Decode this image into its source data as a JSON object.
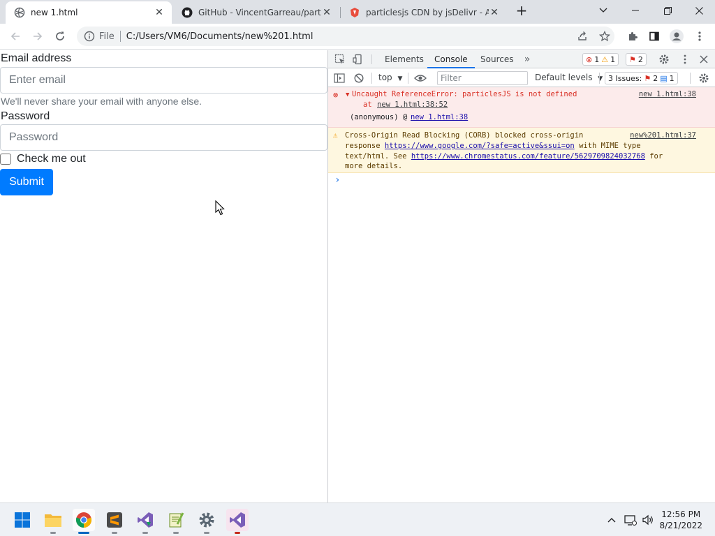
{
  "browser": {
    "tabs": [
      {
        "title": "new 1.html",
        "active": true
      },
      {
        "title": "GitHub - VincentGarreau/particle",
        "active": false
      },
      {
        "title": "particlesjs CDN by jsDelivr - A CD",
        "active": false
      }
    ],
    "address": {
      "scheme_label": "File",
      "url": "C:/Users/VM6/Documents/new%201.html"
    }
  },
  "page": {
    "email_label": "Email address",
    "email_placeholder": "Enter email",
    "email_help": "We'll never share your email with anyone else.",
    "password_label": "Password",
    "password_placeholder": "Password",
    "check_label": "Check me out",
    "submit_label": "Submit"
  },
  "devtools": {
    "tabs": [
      "Elements",
      "Console",
      "Sources"
    ],
    "active_tab": "Console",
    "counts": {
      "errors": "1",
      "warnings": "1",
      "issues_badge": "2"
    },
    "console_bar": {
      "context": "top",
      "filter_placeholder": "Filter",
      "levels": "Default levels",
      "issues_label": "3 Issues:",
      "issues_errors": "2",
      "issues_info": "1"
    },
    "messages": {
      "error": {
        "text": "Uncaught ReferenceError: particlesJS is not defined",
        "at_prefix": "at",
        "at_link": "new 1.html:38:52",
        "source": "new 1.html:38",
        "stack_fn": "(anonymous)",
        "stack_at": "@",
        "stack_link": "new 1.html:38"
      },
      "warning": {
        "line1": "Cross-Origin Read Blocking (CORB) blocked cross-origin",
        "line2_prefix": "response",
        "line2_url": "https://www.google.com/?safe=active&ssui=on",
        "line2_suffix": "with MIME type",
        "line3_prefix": "text/html. See",
        "line3_url": "https://www.chromestatus.com/feature/5629709824032768",
        "line3_suffix": "for",
        "line4": "more details.",
        "source": "new%201.html:37"
      },
      "prompt": "›"
    }
  },
  "taskbar": {
    "time": "12:56 PM",
    "date": "8/21/2022",
    "apps": [
      "start-icon",
      "file-explorer-icon",
      "chrome-icon",
      "sublime-text-icon",
      "visual-studio-installer-icon",
      "notepad-plus-plus-icon",
      "settings-icon",
      "visual-studio-icon"
    ]
  },
  "colors": {
    "accent": "#1a73e8",
    "submit_button": "#007bff",
    "error_text": "#d93025",
    "error_bg": "#fcebeb",
    "warning_bg": "#fef7e0"
  }
}
